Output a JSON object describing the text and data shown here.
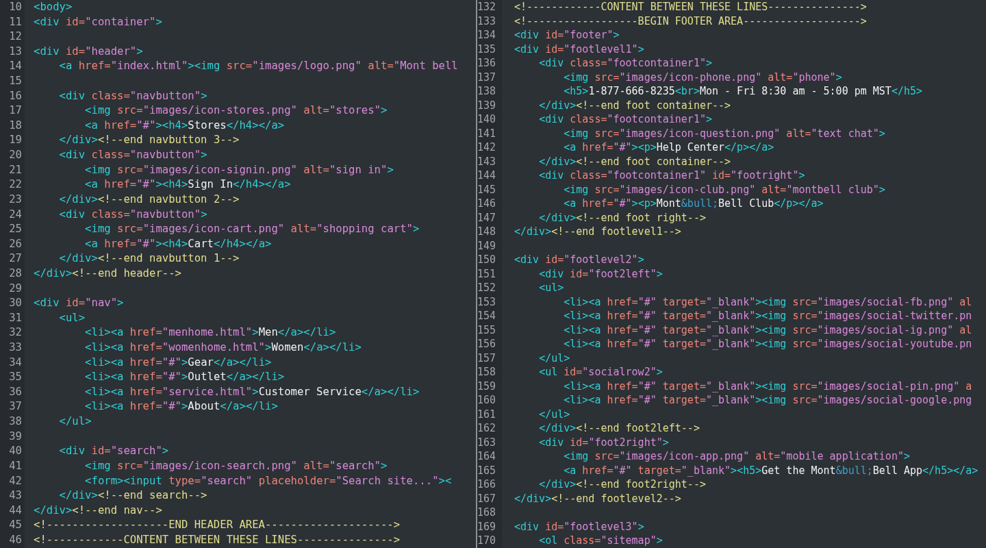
{
  "panes": [
    {
      "lines": [
        {
          "number": "10",
          "text": "<body>"
        },
        {
          "number": "11",
          "text": "<div id=\"container\">"
        },
        {
          "number": "12"
        },
        {
          "number": "13",
          "text": "<div id=\"header\">"
        },
        {
          "number": "14",
          "text": "    <a href=\"index.html\"><img src=\"images/logo.png\" alt=\"Mont bell"
        },
        {
          "number": "15"
        },
        {
          "number": "16",
          "text": "    <div class=\"navbutton\">"
        },
        {
          "number": "17",
          "text": "        <img src=\"images/icon-stores.png\" alt=\"stores\">"
        },
        {
          "number": "18",
          "text": "        <a href=\"#\"><h4>Stores</h4></a>"
        },
        {
          "number": "19",
          "text": "    </div><!--end navbutton 3-->"
        },
        {
          "number": "20",
          "text": "    <div class=\"navbutton\">"
        },
        {
          "number": "21",
          "text": "        <img src=\"images/icon-signin.png\" alt=\"sign in\">"
        },
        {
          "number": "22",
          "text": "        <a href=\"#\"><h4>Sign In</h4></a>"
        },
        {
          "number": "23",
          "text": "    </div><!--end navbutton 2-->"
        },
        {
          "number": "24",
          "text": "    <div class=\"navbutton\">"
        },
        {
          "number": "25",
          "text": "        <img src=\"images/icon-cart.png\" alt=\"shopping cart\">"
        },
        {
          "number": "26",
          "text": "        <a href=\"#\"><h4>Cart</h4></a>"
        },
        {
          "number": "27",
          "text": "    </div><!--end navbutton 1-->"
        },
        {
          "number": "28",
          "text": "</div><!--end header-->"
        },
        {
          "number": "29"
        },
        {
          "number": "30",
          "text": "<div id=\"nav\">"
        },
        {
          "number": "31",
          "text": "    <ul>"
        },
        {
          "number": "32",
          "text": "        <li><a href=\"menhome.html\">Men</a></li>"
        },
        {
          "number": "33",
          "text": "        <li><a href=\"womenhome.html\">Women</a></li>"
        },
        {
          "number": "34",
          "text": "        <li><a href=\"#\">Gear</a></li>"
        },
        {
          "number": "35",
          "text": "        <li><a href=\"#\">Outlet</a></li>"
        },
        {
          "number": "36",
          "text": "        <li><a href=\"service.html\">Customer Service</a></li>"
        },
        {
          "number": "37",
          "text": "        <li><a href=\"#\">About</a></li>"
        },
        {
          "number": "38",
          "text": "    </ul>"
        },
        {
          "number": "39"
        },
        {
          "number": "40",
          "text": "    <div id=\"search\">"
        },
        {
          "number": "41",
          "text": "        <img src=\"images/icon-search.png\" alt=\"search\">"
        },
        {
          "number": "42",
          "text": "        <form><input type=\"search\" placeholder=\"Search site...\"><"
        },
        {
          "number": "43",
          "text": "    </div><!--end search-->"
        },
        {
          "number": "44",
          "text": "</div><!--end nav-->"
        },
        {
          "number": "45",
          "text": "<!-------------------END HEADER AREA-------------------->"
        },
        {
          "number": "46",
          "text": "<!------------CONTENT BETWEEN THESE LINES--------------->"
        }
      ]
    },
    {
      "lines": [
        {
          "number": "132",
          "text": "<!------------CONTENT BETWEEN THESE LINES--------------->"
        },
        {
          "number": "133",
          "text": "<!------------------BEGIN FOOTER AREA------------------->"
        },
        {
          "number": "134",
          "text": "<div id=\"footer\">"
        },
        {
          "number": "135",
          "text": "<div id=\"footlevel1\">"
        },
        {
          "number": "136",
          "text": "    <div class=\"footcontainer1\">"
        },
        {
          "number": "137",
          "text": "        <img src=\"images/icon-phone.png\" alt=\"phone\">"
        },
        {
          "number": "138",
          "text": "        <h5>1-877-666-8235<br>Mon - Fri 8:30 am - 5:00 pm MST</h5>"
        },
        {
          "number": "139",
          "text": "    </div><!--end foot container-->"
        },
        {
          "number": "140",
          "text": "    <div class=\"footcontainer1\">"
        },
        {
          "number": "141",
          "text": "        <img src=\"images/icon-question.png\" alt=\"text chat\">"
        },
        {
          "number": "142",
          "text": "        <a href=\"#\"><p>Help Center</p></a>"
        },
        {
          "number": "143",
          "text": "    </div><!--end foot container-->"
        },
        {
          "number": "144",
          "text": "    <div class=\"footcontainer1\" id=\"footright\">"
        },
        {
          "number": "145",
          "text": "        <img src=\"images/icon-club.png\" alt=\"montbell club\">"
        },
        {
          "number": "146",
          "text": "        <a href=\"#\"><p>Mont&bull;Bell Club</p></a>"
        },
        {
          "number": "147",
          "text": "    </div><!--end foot right-->"
        },
        {
          "number": "148",
          "text": "</div><!--end footlevel1-->"
        },
        {
          "number": "149"
        },
        {
          "number": "150",
          "text": "<div id=\"footlevel2\">"
        },
        {
          "number": "151",
          "text": "    <div id=\"foot2left\">"
        },
        {
          "number": "152",
          "text": "    <ul>"
        },
        {
          "number": "153",
          "text": "        <li><a href=\"#\" target=\"_blank\"><img src=\"images/social-fb.png\" al"
        },
        {
          "number": "154",
          "text": "        <li><a href=\"#\" target=\"_blank\"><img src=\"images/social-twitter.pn"
        },
        {
          "number": "155",
          "text": "        <li><a href=\"#\" target=\"_blank\"><img src=\"images/social-ig.png\" al"
        },
        {
          "number": "156",
          "text": "        <li><a href=\"#\" target=\"_blank\"><img src=\"images/social-youtube.pn"
        },
        {
          "number": "157",
          "text": "    </ul>"
        },
        {
          "number": "158",
          "text": "    <ul id=\"socialrow2\">"
        },
        {
          "number": "159",
          "text": "        <li><a href=\"#\" target=\"_blank\"><img src=\"images/social-pin.png\" a"
        },
        {
          "number": "160",
          "text": "        <li><a href=\"#\" target=\"_blank\"><img src=\"images/social-google.png"
        },
        {
          "number": "161",
          "text": "    </ul>"
        },
        {
          "number": "162",
          "text": "    </div><!--end foot2left-->"
        },
        {
          "number": "163",
          "text": "    <div id=\"foot2right\">"
        },
        {
          "number": "164",
          "text": "        <img src=\"images/icon-app.png\" alt=\"mobile application\">"
        },
        {
          "number": "165",
          "text": "        <a href=\"#\" target=\"_blank\"><h5>Get the Mont&bull;Bell App</h5></a>"
        },
        {
          "number": "166",
          "text": "    </div><!--end foot2right-->"
        },
        {
          "number": "167",
          "text": "</div><!--end footlevel2-->"
        },
        {
          "number": "168"
        },
        {
          "number": "169",
          "text": "<div id=\"footlevel3\">"
        },
        {
          "number": "170",
          "text": "    <ol class=\"sitemap\">"
        }
      ]
    }
  ]
}
